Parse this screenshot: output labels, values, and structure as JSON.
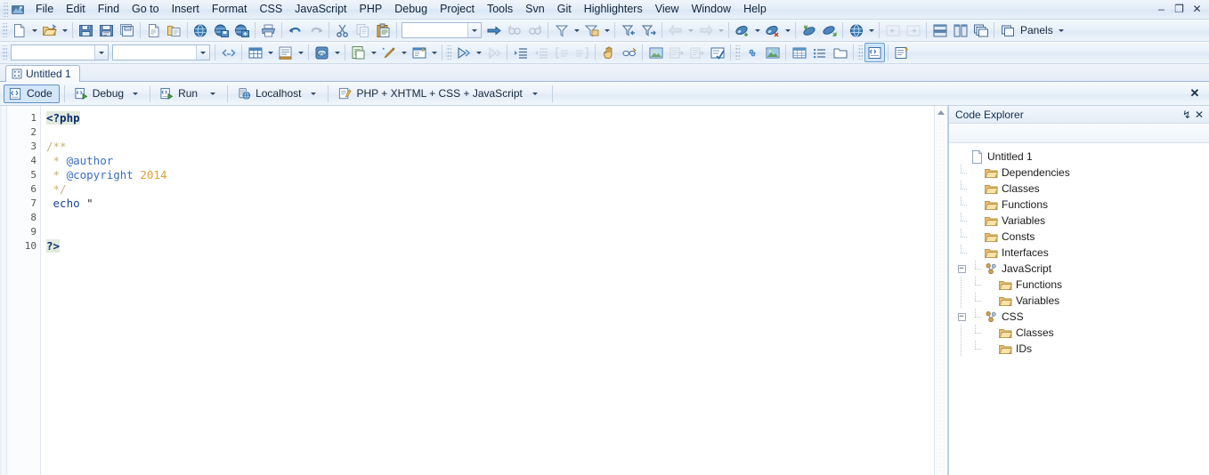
{
  "window": {
    "minimize_label": "–",
    "restore_label": "❐",
    "close_label": "✕"
  },
  "menu": {
    "items": [
      "File",
      "Edit",
      "Find",
      "Go to",
      "Insert",
      "Format",
      "CSS",
      "JavaScript",
      "PHP",
      "Debug",
      "Project",
      "Tools",
      "Svn",
      "Git",
      "Highlighters",
      "View",
      "Window",
      "Help"
    ]
  },
  "toolbar_main": {
    "combo_value": "",
    "panels_label": "Panels",
    "buttons": [
      "new-file-icon",
      "open-file-icon",
      "save-icon",
      "save-as-icon",
      "save-all-icon",
      "new-from-template-icon",
      "open-folder-icon",
      "publish-icon",
      "download-icon",
      "upload-icon",
      "print-icon",
      "undo-icon",
      "redo-icon",
      "cut-icon",
      "copy-icon",
      "paste-icon",
      "find-next-icon",
      "find-previous-icon",
      "find-icon",
      "filter-icon",
      "filter-folder-icon",
      "filter-back-icon",
      "filter-forward-icon",
      "back-icon",
      "forward-icon",
      "bookmark-add-icon",
      "bookmark-remove-icon",
      "bookmark-prev-icon",
      "bookmark-next-icon",
      "preview-browser-icon",
      "nav-back-icon",
      "nav-forward-icon",
      "layout-horizontal-icon",
      "layout-vertical-icon",
      "layout-cascade-icon",
      "panels-icon"
    ]
  },
  "toolbar_secondary": {
    "combo1_value": "",
    "combo2_value": "",
    "buttons": [
      "quick-tag-icon",
      "table-icon",
      "form-icon",
      "php-snippet-icon",
      "php-menu-icon",
      "html-snippet-icon",
      "wand-icon",
      "validate-icon",
      "run-script-icon",
      "debug-step-icon",
      "indent-icon",
      "outdent-icon",
      "comment-icon",
      "uncomment-icon",
      "hand-icon",
      "spellcheck-icon",
      "image-icon",
      "insert-left-icon",
      "insert-right-icon",
      "check-icon",
      "link-icon",
      "picture-icon",
      "table-insert-icon",
      "list-icon",
      "folder-icon",
      "code-view-icon",
      "design-view-icon",
      "preview-icon",
      "browse-icon",
      "localhost-icon",
      "php-file-icon"
    ]
  },
  "document": {
    "tab_label": "Untitled 1",
    "tab_icon": "document-icon",
    "close_label": "✕",
    "buttons": [
      {
        "label": "Code",
        "icon": "code-icon",
        "selected": true,
        "has_dropdown": false
      },
      {
        "label": "Debug",
        "icon": "debug-icon",
        "selected": false,
        "has_dropdown": true
      },
      {
        "label": "Run",
        "icon": "run-icon",
        "selected": false,
        "has_dropdown": true
      },
      {
        "label": "Localhost",
        "icon": "server-icon",
        "selected": false,
        "has_dropdown": true
      },
      {
        "label": "PHP + XHTML + CSS + JavaScript",
        "icon": "highlighter-icon",
        "selected": false,
        "has_dropdown": true
      }
    ]
  },
  "editor": {
    "line_numbers": [
      "1",
      "2",
      "3",
      "4",
      "5",
      "6",
      "7",
      "8",
      "9",
      "10"
    ],
    "lines": [
      {
        "n": 1,
        "tokens": [
          {
            "t": "<?php",
            "c": "tag"
          }
        ]
      },
      {
        "n": 2,
        "tokens": []
      },
      {
        "n": 3,
        "tokens": [
          {
            "t": "/**",
            "c": "com"
          }
        ]
      },
      {
        "n": 4,
        "tokens": [
          {
            "t": " * ",
            "c": "com"
          },
          {
            "t": "@author",
            "c": "doc"
          }
        ]
      },
      {
        "n": 5,
        "tokens": [
          {
            "t": " * ",
            "c": "com"
          },
          {
            "t": "@copyright",
            "c": "doc"
          },
          {
            "t": " ",
            "c": "com"
          },
          {
            "t": "2014",
            "c": "num"
          }
        ]
      },
      {
        "n": 6,
        "tokens": [
          {
            "t": " */",
            "c": "com"
          }
        ]
      },
      {
        "n": 7,
        "tokens": [
          {
            "t": " ",
            "c": "str"
          },
          {
            "t": "echo",
            "c": "kw"
          },
          {
            "t": " \"",
            "c": "str"
          }
        ]
      },
      {
        "n": 8,
        "tokens": []
      },
      {
        "n": 9,
        "tokens": []
      },
      {
        "n": 10,
        "tokens": [
          {
            "t": "?>",
            "c": "tag"
          }
        ]
      }
    ]
  },
  "explorer": {
    "title": "Code Explorer",
    "pin_label": "↯",
    "close_label": "✕",
    "tree": [
      {
        "label": "Untitled 1",
        "icon": "document-icon",
        "depth": 0,
        "toggle": "none"
      },
      {
        "label": "Dependencies",
        "icon": "folder-icon",
        "depth": 1,
        "toggle": "none"
      },
      {
        "label": "Classes",
        "icon": "folder-icon",
        "depth": 1,
        "toggle": "none"
      },
      {
        "label": "Functions",
        "icon": "folder-icon",
        "depth": 1,
        "toggle": "none"
      },
      {
        "label": "Variables",
        "icon": "folder-icon",
        "depth": 1,
        "toggle": "none"
      },
      {
        "label": "Consts",
        "icon": "folder-icon",
        "depth": 1,
        "toggle": "none"
      },
      {
        "label": "Interfaces",
        "icon": "folder-icon",
        "depth": 1,
        "toggle": "none"
      },
      {
        "label": "JavaScript",
        "icon": "script-icon",
        "depth": 1,
        "toggle": "minus"
      },
      {
        "label": "Functions",
        "icon": "folder-icon",
        "depth": 2,
        "toggle": "none"
      },
      {
        "label": "Variables",
        "icon": "folder-icon",
        "depth": 2,
        "toggle": "none"
      },
      {
        "label": "CSS",
        "icon": "script-icon",
        "depth": 1,
        "toggle": "minus"
      },
      {
        "label": "Classes",
        "icon": "folder-icon",
        "depth": 2,
        "toggle": "none"
      },
      {
        "label": "IDs",
        "icon": "folder-icon",
        "depth": 2,
        "toggle": "none"
      }
    ]
  },
  "colors": {
    "chrome_blue": "#dae6f5",
    "tag_highlight": "#e2eade",
    "comment": "#c9b27a",
    "docblock": "#3b6fc4",
    "number": "#d8a13a",
    "keyword": "#16478f",
    "folder": "#e8bf6a"
  }
}
